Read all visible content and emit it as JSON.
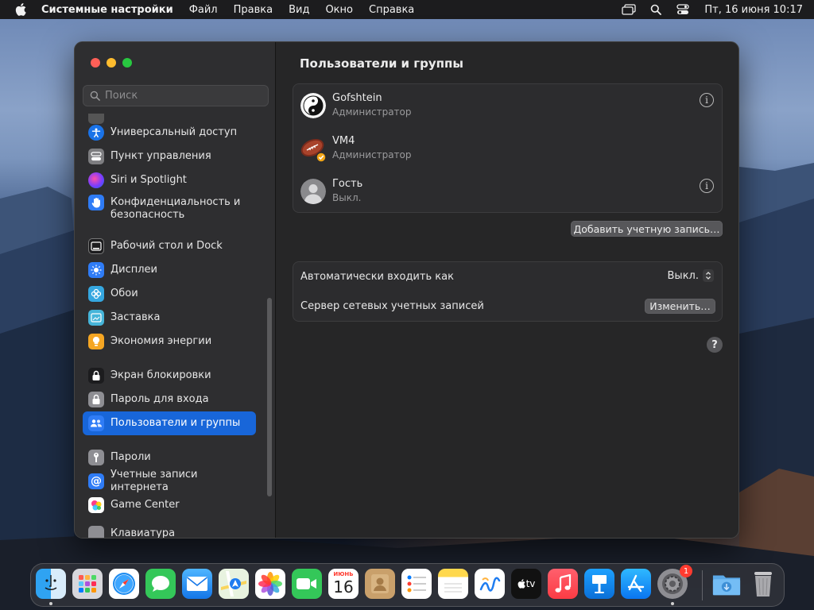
{
  "menubar": {
    "app_name": "Системные настройки",
    "menus": [
      "Файл",
      "Правка",
      "Вид",
      "Окно",
      "Справка"
    ],
    "clock": "Пт, 16 июня  10:17",
    "status_icons": [
      "screen-mirroring-icon",
      "search-icon",
      "control-center-icon"
    ]
  },
  "sidebar": {
    "search_placeholder": "Поиск",
    "items": [
      {
        "label": "Универсальный доступ",
        "icon": "accessibility-icon",
        "color": "#1a73e8"
      },
      {
        "label": "Пункт управления",
        "icon": "control-center-icon",
        "color": "#7d7d80"
      },
      {
        "label": "Siri и Spotlight",
        "icon": "siri-icon",
        "color": "#8a3ffc"
      },
      {
        "label": "Конфиденциальность и безопасность",
        "icon": "hand-icon",
        "color": "#2f7cf6"
      },
      {
        "label": "Рабочий стол и Dock",
        "icon": "dock-icon",
        "color": "#1c1c1e"
      },
      {
        "label": "Дисплеи",
        "icon": "sun-icon",
        "color": "#2f7cf6"
      },
      {
        "label": "Обои",
        "icon": "flower-icon",
        "color": "#35a7e0"
      },
      {
        "label": "Заставка",
        "icon": "screensaver-icon",
        "color": "#46b5d9"
      },
      {
        "label": "Экономия энергии",
        "icon": "bulb-icon",
        "color": "#f5a623"
      },
      {
        "label": "Экран блокировки",
        "icon": "lock-icon",
        "color": "#1c1c1e"
      },
      {
        "label": "Пароль для входа",
        "icon": "padlock-icon",
        "color": "#8e8e93"
      },
      {
        "label": "Пользователи и группы",
        "icon": "users-icon",
        "color": "#2f7cf6",
        "active": true
      },
      {
        "label": "Пароли",
        "icon": "key-icon",
        "color": "#8e8e93"
      },
      {
        "label": "Учетные записи интернета",
        "icon": "at-icon",
        "color": "#2f7cf6"
      },
      {
        "label": "Game Center",
        "icon": "game-center-icon",
        "color": "#ffffff"
      },
      {
        "label": "Клавиатура",
        "icon": "keyboard-icon",
        "color": "#8e8e93"
      }
    ]
  },
  "main": {
    "title": "Пользователи и группы",
    "users": [
      {
        "name": "Gofshtein",
        "role": "Администратор",
        "avatar": "yin-yang-avatar",
        "info": true
      },
      {
        "name": "VM4",
        "role": "Администратор",
        "avatar": "football-avatar",
        "info": false
      },
      {
        "name": "Гость",
        "role": "Выкл.",
        "avatar": "guest-avatar",
        "info": true
      }
    ],
    "add_account_button": "Добавить учетную запись…",
    "auto_login_label": "Автоматически входить как",
    "auto_login_value": "Выкл.",
    "network_server_label": "Сервер сетевых учетных записей",
    "edit_button": "Изменить…",
    "help_glyph": "?"
  },
  "dock": {
    "apps": [
      "finder-icon",
      "launchpad-icon",
      "safari-icon",
      "messages-icon",
      "mail-icon",
      "maps-icon",
      "photos-icon",
      "facetime-icon",
      "calendar-icon",
      "contacts-icon",
      "reminders-icon",
      "notes-icon",
      "freeform-icon",
      "appletv-icon",
      "music-icon",
      "keynote-icon",
      "appstore-icon",
      "settings-icon"
    ],
    "calendar_month": "ИЮНЬ",
    "calendar_day": "16",
    "settings_badge": "1",
    "tv_label": "tv",
    "extras": [
      "downloads-icon",
      "trash-icon"
    ]
  }
}
